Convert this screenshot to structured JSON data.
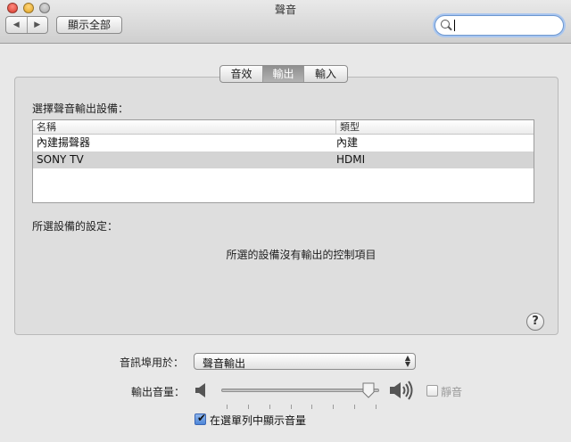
{
  "window": {
    "title": "聲音"
  },
  "toolbar": {
    "back_glyph": "◀",
    "forward_glyph": "▶",
    "show_all_label": "顯示全部",
    "search_value": ""
  },
  "tabs": [
    {
      "label": "音效",
      "selected": false
    },
    {
      "label": "輸出",
      "selected": true
    },
    {
      "label": "輸入",
      "selected": false
    }
  ],
  "output": {
    "select_device_label": "選擇聲音輸出設備：",
    "columns": {
      "name": "名稱",
      "type": "類型"
    },
    "devices": [
      {
        "name": "內建揚聲器",
        "type": "內建",
        "selected": false
      },
      {
        "name": "SONY TV",
        "type": "HDMI",
        "selected": true
      }
    ],
    "settings_label": "所選設備的設定：",
    "no_controls_message": "所選的設備沒有輸出的控制項目",
    "help_glyph": "?"
  },
  "bottom": {
    "play_through_label": "音訊埠用於：",
    "play_through_value": "聲音輸出",
    "popup_arrows": "▲▼",
    "output_volume_label": "輸出音量：",
    "volume_level": 0.97,
    "mute_label": "靜音",
    "mute_checked": false,
    "mute_enabled": false,
    "show_in_menubar_label": "在選單列中顯示音量",
    "show_in_menubar_checked": true,
    "checkmark_glyph": "✔"
  },
  "colors": {
    "accent": "#4d86d8",
    "selected_row": "#d4d4d4",
    "selected_tab": "#9c9c9c"
  }
}
